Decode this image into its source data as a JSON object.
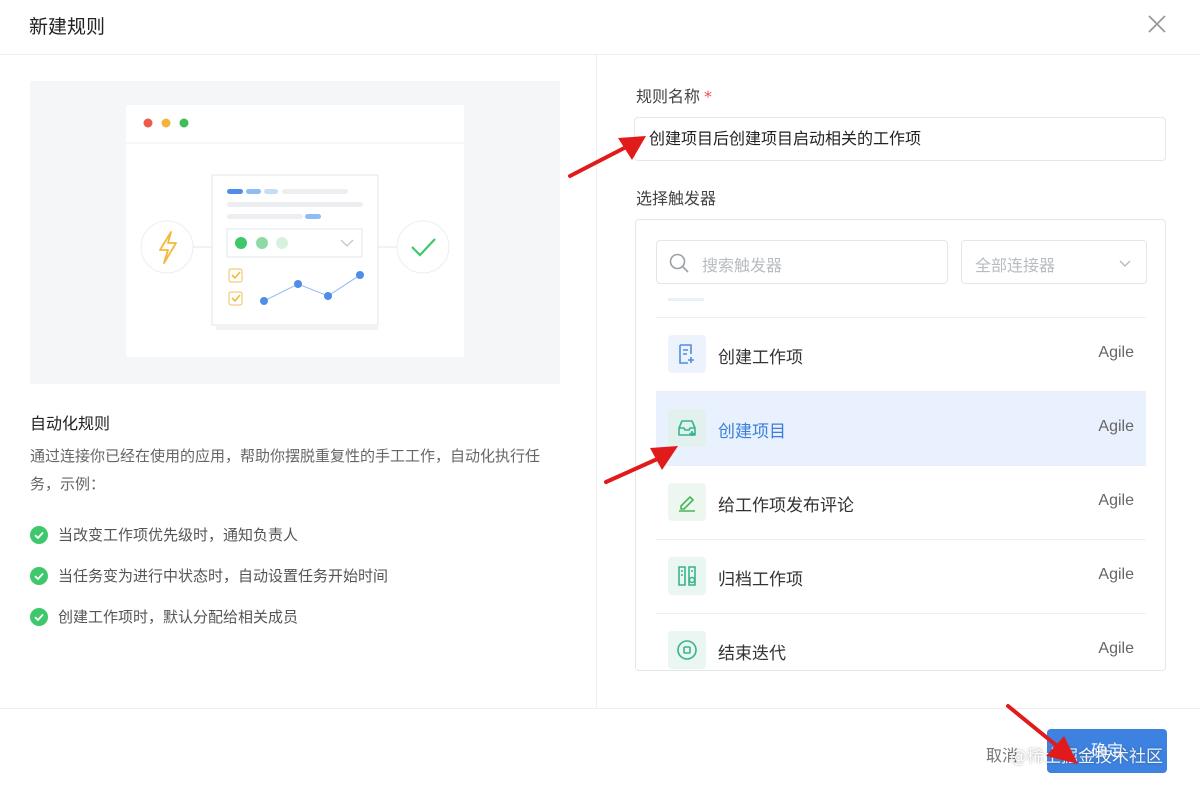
{
  "dialog": {
    "title": "新建规则"
  },
  "intro": {
    "title": "自动化规则",
    "description": "通过连接你已经在使用的应用，帮助你摆脱重复性的手工工作，自动化执行任务，示例：",
    "examples": [
      "当改变工作项优先级时，通知负责人",
      "当任务变为进行中状态时，自动设置任务开始时间",
      "创建工作项时，默认分配给相关成员"
    ]
  },
  "form": {
    "name_label": "规则名称",
    "required_mark": "*",
    "name_value": "创建项目后创建项目启动相关的工作项",
    "trigger_label": "选择触发器",
    "search_placeholder": "搜索触发器",
    "connector_select": "全部连接器"
  },
  "triggers": [
    {
      "name": "创建工作项",
      "tag": "Agile",
      "icon": "document-add-icon",
      "color": "#4f8de6",
      "bg": "#edf3fc"
    },
    {
      "name": "创建项目",
      "tag": "Agile",
      "icon": "inbox-add-icon",
      "color": "#37b394",
      "bg": "#e2f1ee",
      "selected": true
    },
    {
      "name": "给工作项发布评论",
      "tag": "Agile",
      "icon": "pen-icon",
      "color": "#48b55a",
      "bg": "#eef7ef"
    },
    {
      "name": "归档工作项",
      "tag": "Agile",
      "icon": "archive-icon",
      "color": "#3ab38a",
      "bg": "#eaf6f1"
    },
    {
      "name": "结束迭代",
      "tag": "Agile",
      "icon": "circle-stop-icon",
      "color": "#3ab38a",
      "bg": "#eaf6f1"
    }
  ],
  "footer": {
    "cancel_label": "取消",
    "confirm_label": "确定",
    "watermark": "@稀土掘金技术社区"
  },
  "colors": {
    "primary": "#3d82e0",
    "success": "#3ec86b",
    "annotation": "#e11b1b"
  }
}
